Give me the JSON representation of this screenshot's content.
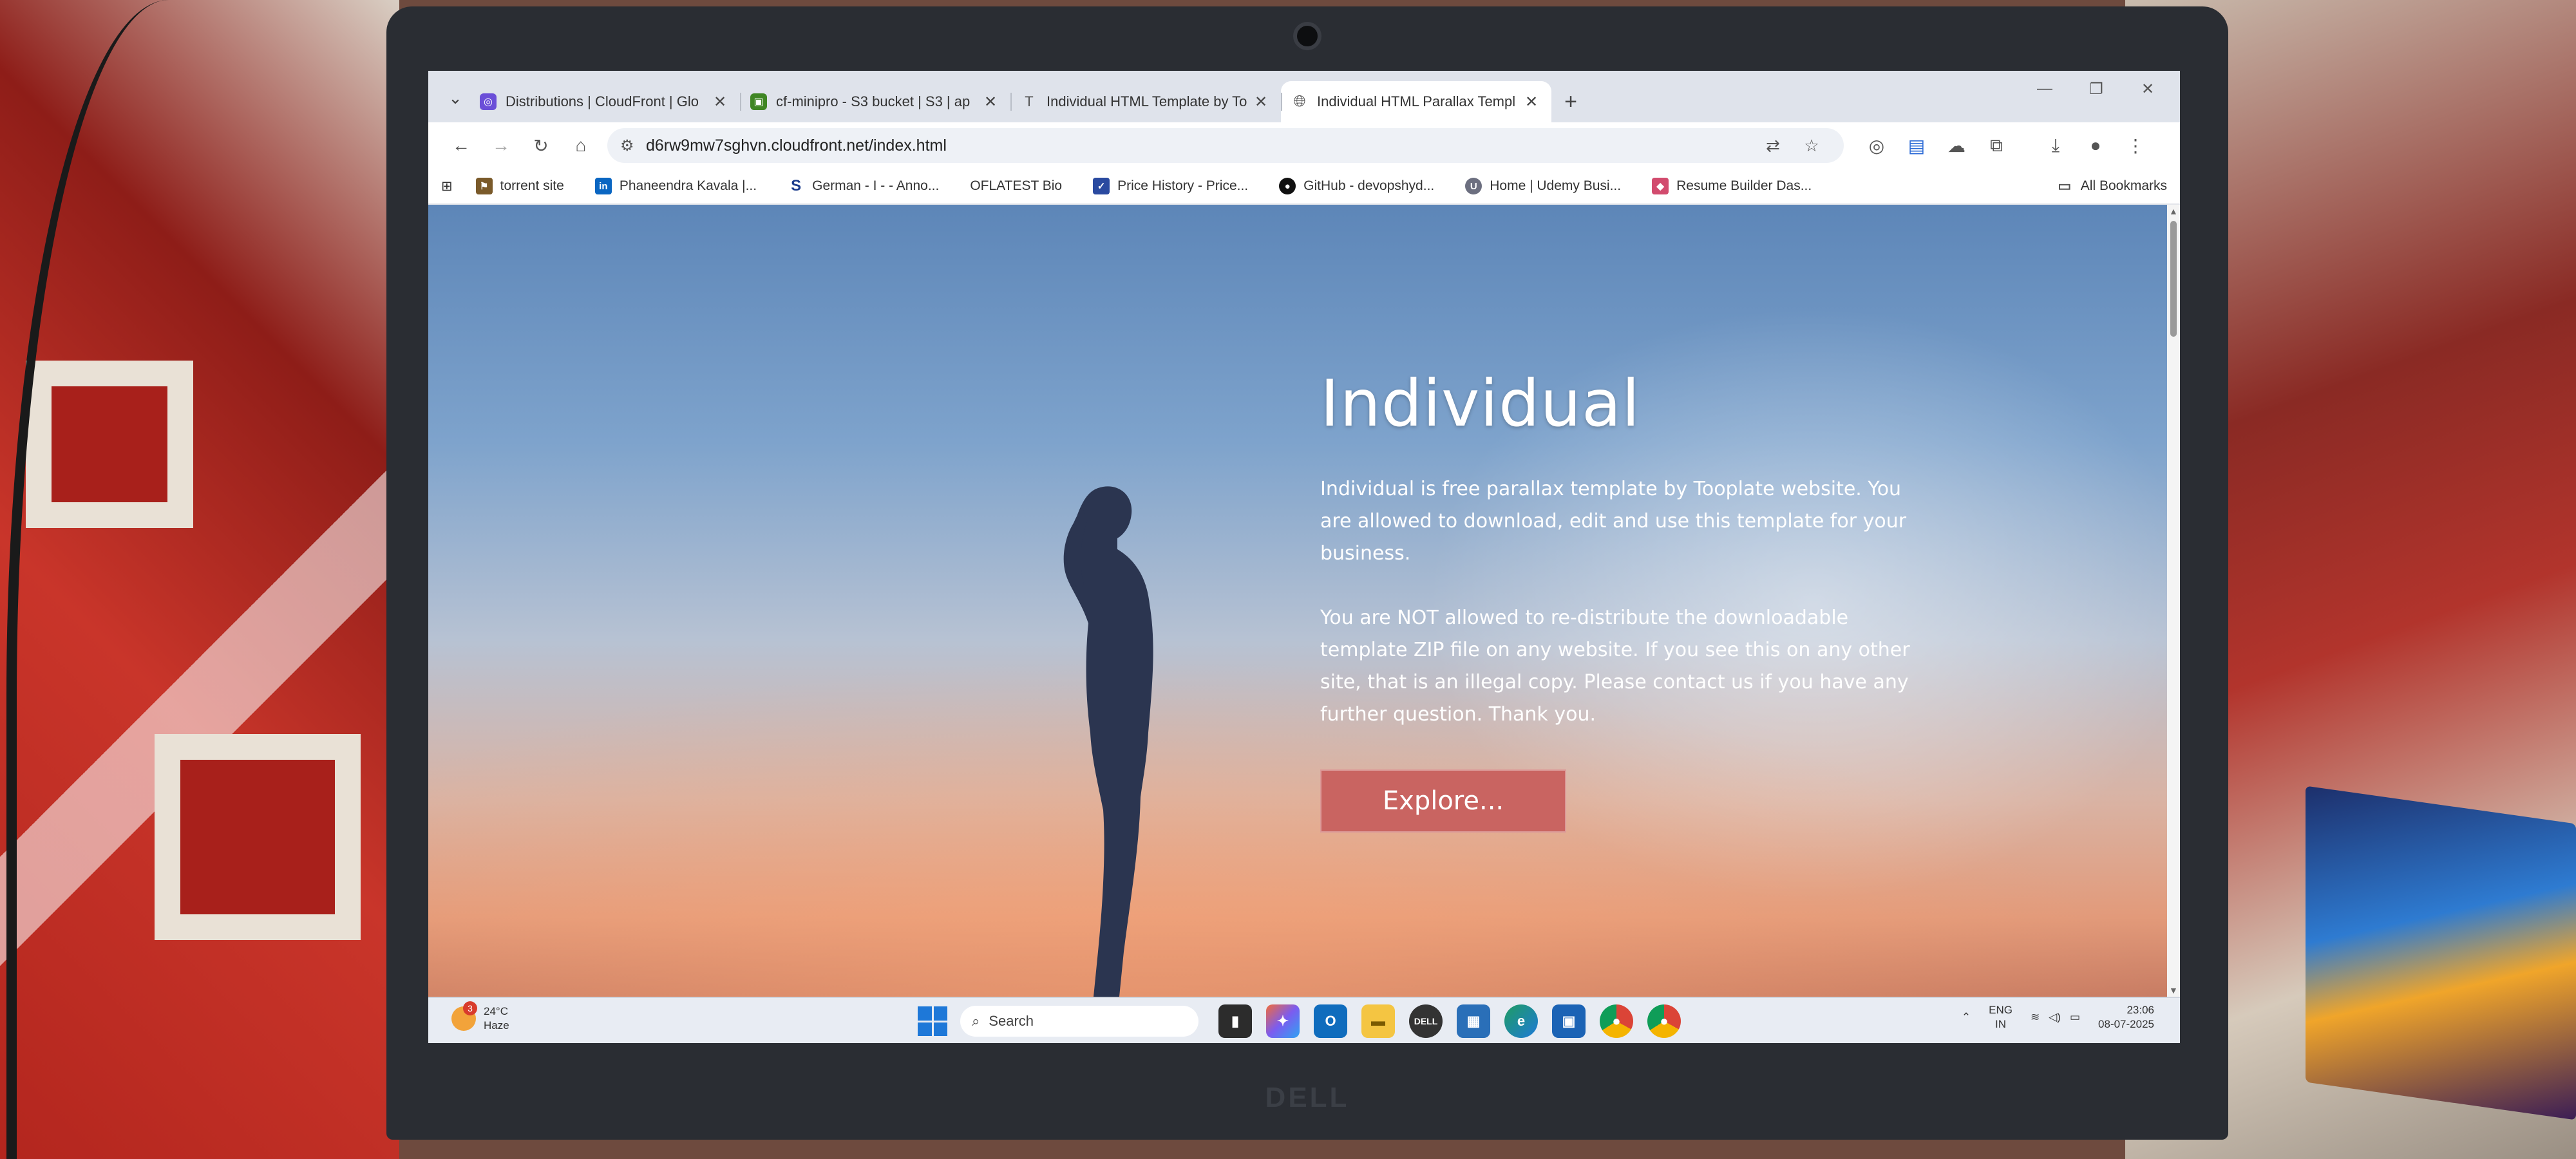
{
  "browser": {
    "tabs": [
      {
        "title": "Distributions | CloudFront | Glo",
        "favicon": "cloudfront-icon",
        "active": false
      },
      {
        "title": "cf-minipro - S3 bucket | S3 | ap",
        "favicon": "s3-icon",
        "active": false
      },
      {
        "title": "Individual HTML Template by To",
        "favicon": "tooplate-icon",
        "active": false
      },
      {
        "title": "Individual HTML Parallax Templ",
        "favicon": "globe-icon",
        "active": true
      }
    ],
    "url": "d6rw9mw7sghvn.cloudfront.net/index.html",
    "bookmarks": [
      {
        "label": "torrent site",
        "icon": "torrent-icon"
      },
      {
        "label": "Phaneendra Kavala |...",
        "icon": "linkedin-icon"
      },
      {
        "label": "German - I - - Anno...",
        "icon": "s-icon"
      },
      {
        "label": "OFLATEST Bio",
        "icon": "none"
      },
      {
        "label": "Price History - Price...",
        "icon": "price-icon"
      },
      {
        "label": "GitHub - devopshyd...",
        "icon": "github-icon"
      },
      {
        "label": "Home | Udemy Busi...",
        "icon": "udemy-icon"
      },
      {
        "label": "Resume Builder Das...",
        "icon": "resume-icon"
      }
    ],
    "all_bookmarks_label": "All Bookmarks"
  },
  "page": {
    "title": "Individual",
    "paragraph1": "Individual is free parallax template by Tooplate website. You are allowed to download, edit and use this template for your business.",
    "paragraph2": "You are NOT allowed to re-distribute the downloadable template ZIP file on any website. If you see this on any other site, that is an illegal copy. Please contact us if you have any further question. Thank you.",
    "button_label": "Explore..."
  },
  "taskbar": {
    "weather_temp": "24°C",
    "weather_desc": "Haze",
    "weather_badge": "3",
    "search_placeholder": "Search",
    "lang_top": "ENG",
    "lang_bottom": "IN",
    "time": "23:06",
    "date": "08-07-2025"
  },
  "device": {
    "brand": "DELL"
  },
  "colors": {
    "explore_button": "#c96461",
    "tabstrip": "#dfe3eb"
  }
}
